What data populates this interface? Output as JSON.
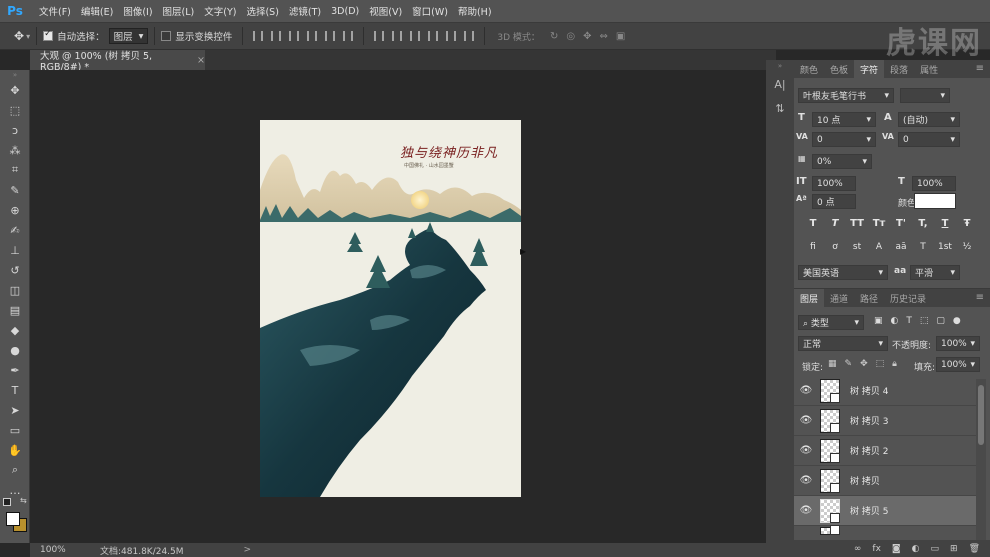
{
  "app": {
    "logo": "Ps"
  },
  "menu": [
    "文件(F)",
    "编辑(E)",
    "图像(I)",
    "图层(L)",
    "文字(Y)",
    "选择(S)",
    "滤镜(T)",
    "3D(D)",
    "视图(V)",
    "窗口(W)",
    "帮助(H)"
  ],
  "watermark": "虎课网",
  "options": {
    "auto_select_label": "自动选择：",
    "auto_select_value": "图层",
    "show_transform_label": "显示变换控件",
    "mode3d_label": "3D 模式："
  },
  "document": {
    "tab_title": "大观 @ 100% (树 拷贝 5, RGB/8#) *",
    "tab_close": "×"
  },
  "status": {
    "zoom": "100%",
    "doc_info": "文档:481.8K/24.5M",
    "arrow": ">"
  },
  "poster": {
    "title": "独与绕神历非凡",
    "subtitle": "中国佛礼 · 山水园墨蟹"
  },
  "char_panel": {
    "tabs": [
      "颜色",
      "色板",
      "字符",
      "段落",
      "属性"
    ],
    "active_tab": "字符",
    "font_family": "叶根友毛笔行书",
    "font_size": "10 点",
    "leading": "(自动)",
    "kerning": "0",
    "tracking": "0",
    "tsume": "0%",
    "vertical_scale": "100%",
    "horizontal_scale": "100%",
    "baseline_shift": "0 点",
    "color_label": "颜色:",
    "text_color": "#ffffff",
    "style_buttons": [
      "T",
      "T",
      "TT",
      "Tт",
      "T'",
      "T,",
      "T",
      "Ŧ"
    ],
    "opentype_buttons": [
      "fi",
      "ơ",
      "st",
      "A",
      "aā",
      "T",
      "1st",
      "½"
    ],
    "language": "美国英语",
    "aa_label": "aa",
    "antialias": "平滑"
  },
  "layers_panel": {
    "tabs": [
      "图层",
      "通道",
      "路径",
      "历史记录"
    ],
    "filter_label": "类型",
    "blend_mode": "正常",
    "opacity_label": "不透明度:",
    "opacity": "100%",
    "lock_label": "锁定:",
    "fill_label": "填充:",
    "fill": "100%",
    "layers": [
      {
        "name": "树 拷贝 4",
        "selected": false
      },
      {
        "name": "树 拷贝 3",
        "selected": false
      },
      {
        "name": "树 拷贝 2",
        "selected": false
      },
      {
        "name": "树 拷贝",
        "selected": false
      },
      {
        "name": "树 拷贝 5",
        "selected": true
      }
    ]
  }
}
